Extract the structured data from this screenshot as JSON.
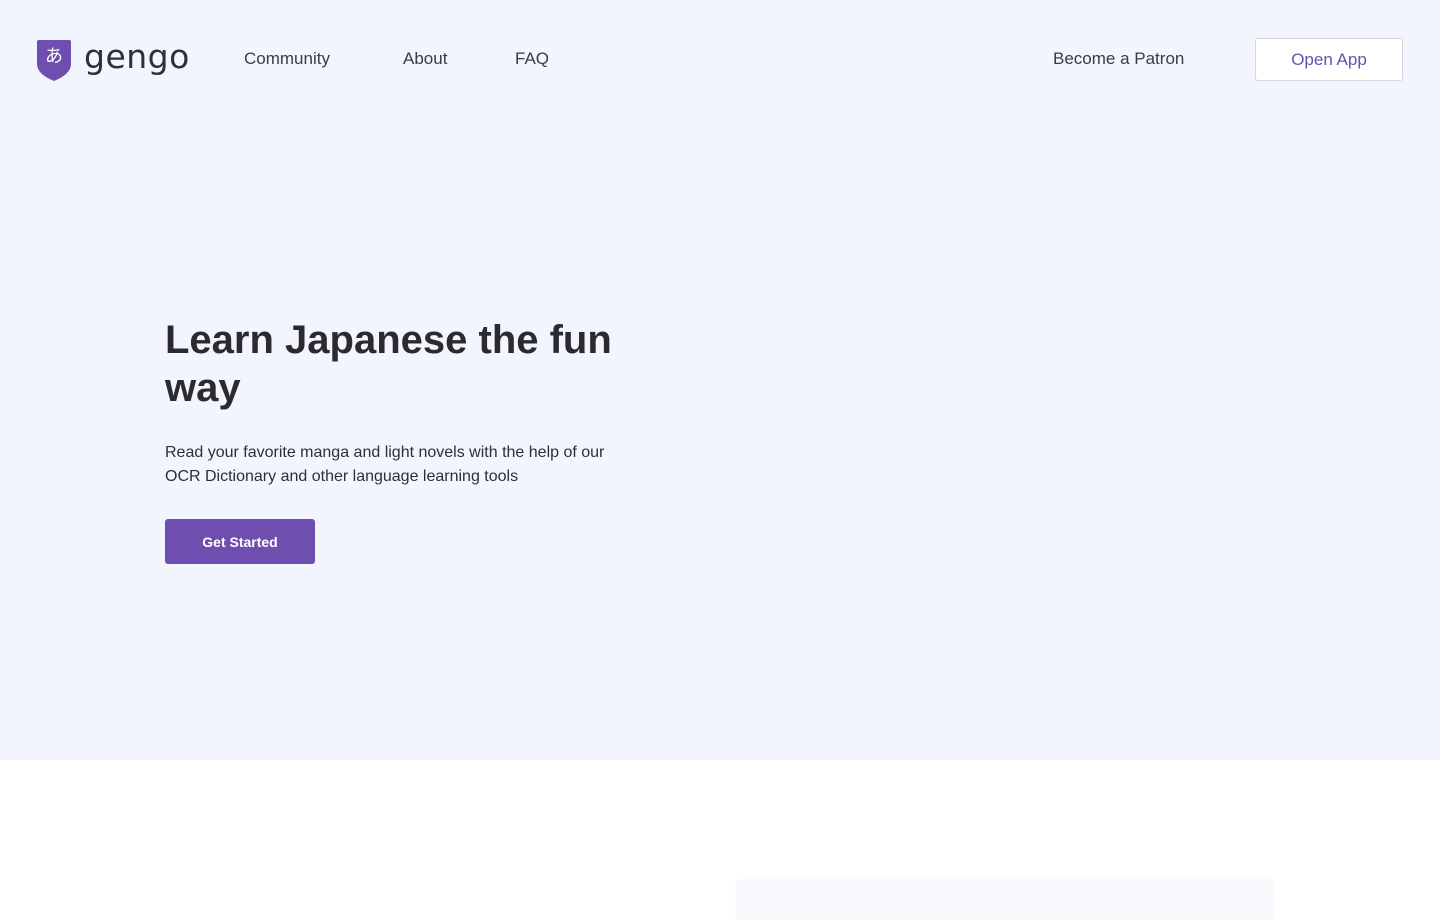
{
  "brand": {
    "name": "gengo",
    "badge_glyph": "あ",
    "badge_color": "#6e4eaf",
    "logo_icon": "shield-badge-icon"
  },
  "nav": {
    "links": [
      {
        "label": "Community"
      },
      {
        "label": "About"
      },
      {
        "label": "FAQ"
      }
    ],
    "patron_label": "Become a Patron",
    "open_app_label": "Open App"
  },
  "hero": {
    "title": "Learn Japanese the fun way",
    "subtitle": "Read your favorite manga and light novels with the help of our OCR Dictionary and other language learning tools",
    "cta_label": "Get Started",
    "background": "#f3f5fe",
    "accent": "#6e4eaf"
  }
}
